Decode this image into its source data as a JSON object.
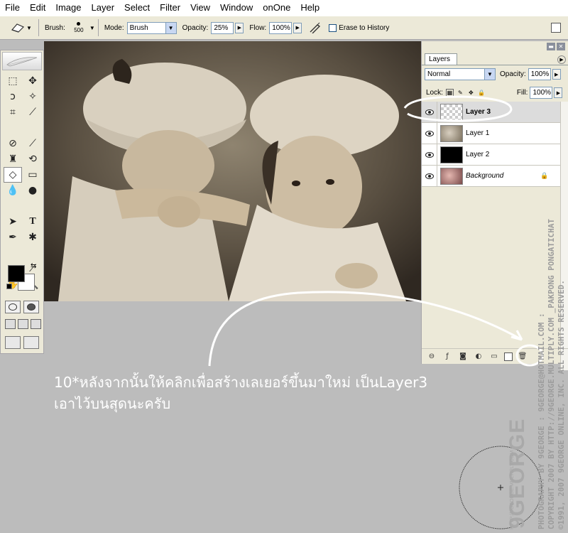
{
  "menubar": {
    "items": [
      "File",
      "Edit",
      "Image",
      "Layer",
      "Select",
      "Filter",
      "View",
      "Window",
      "onOne",
      "Help"
    ]
  },
  "options": {
    "brush_label": "Brush:",
    "brush_size": "500",
    "mode_label": "Mode:",
    "mode_value": "Brush",
    "opacity_label": "Opacity:",
    "opacity_value": "25%",
    "flow_label": "Flow:",
    "flow_value": "100%",
    "erase_history_label": "Erase to History",
    "tool_icon": "eraser-icon"
  },
  "layers_panel": {
    "tab_label": "Layers",
    "blend_mode": "Normal",
    "opacity_label": "Opacity:",
    "opacity_value": "100%",
    "lock_label": "Lock:",
    "fill_label": "Fill:",
    "fill_value": "100%",
    "layers": [
      {
        "name": "Layer 3",
        "thumb": "transparent",
        "active": true
      },
      {
        "name": "Layer 1",
        "thumb": "photo",
        "active": false
      },
      {
        "name": "Layer 2",
        "thumb": "black",
        "active": false
      },
      {
        "name": "Background",
        "thumb": "photo-color",
        "active": false,
        "locked": true
      }
    ]
  },
  "caption": {
    "line1": "10*หลังจากนั้นให้คลิกเพื่อสร้างเลเยอร์ขึ้นมาใหม่  เป็นLayer3",
    "line2": "เอาไว้บนสุดนะครับ"
  },
  "watermark": {
    "line1": "PHOTOGRAPHY BY 9GEORGE : 9GEORGE@HOTMAIL.COM :",
    "line2": "COPYRIGHT 2007 BY  HTTP://9GEORGE.MULTIPLY.COM _PAKPONG PONGATICHAT",
    "line3": "©1991, 2007 9GEORGE ONLINE, INC. ALL RIGHTS RESERVED.",
    "brand": "9GEORGE",
    "brand_url": "HTTP://9GEORGE.MULTIPLY.COM"
  },
  "colors": {
    "foreground": "#000000",
    "background": "#ffffff",
    "annotation": "#ffffff"
  }
}
